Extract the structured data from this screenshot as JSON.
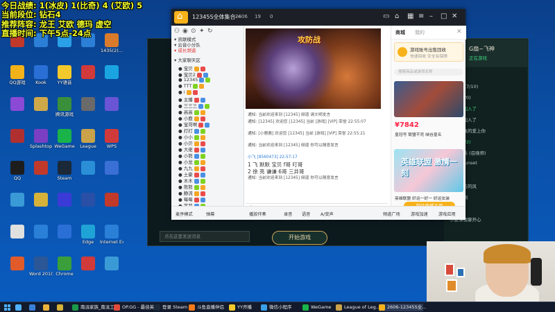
{
  "overlay": {
    "line1": "今日战绩: 1(冰皮) 1(比奇) 4 (艾欧) 5",
    "line2": "当前段位: 钻石4",
    "line3": "推荐阵容: 龙王 艾欧 德玛 虚空",
    "line4": "直播时间: 下午5点-24点"
  },
  "desktop_icons": [
    {
      "label": "",
      "color": "#c0392b"
    },
    {
      "label": "",
      "color": "#2b7fd6"
    },
    {
      "label": "",
      "color": "#2aa0e8"
    },
    {
      "label": "",
      "color": "#2b7fd6"
    },
    {
      "label": "1435(2)...",
      "color": "#d97b2a"
    },
    {
      "label": "QQ游戏",
      "color": "#f2b21a"
    },
    {
      "label": "Kook",
      "color": "#2a6fd6"
    },
    {
      "label": "YY语音",
      "color": "#f3c92b"
    },
    {
      "label": "",
      "color": "#d13a3a"
    },
    {
      "label": "",
      "color": "#1aa5e2"
    },
    {
      "label": "",
      "color": "#8a4ad6"
    },
    {
      "label": "",
      "color": "#cfa84a"
    },
    {
      "label": "腾讯游戏",
      "color": "#3a8f3a"
    },
    {
      "label": "",
      "color": "#6a6a6a"
    },
    {
      "label": "",
      "color": "#6a55d6"
    },
    {
      "label": "",
      "color": "#b03030"
    },
    {
      "label": "Splashtop",
      "color": "#7b3fc4"
    },
    {
      "label": "WeGame",
      "color": "#19b34a"
    },
    {
      "label": "League",
      "color": "#c9a24a"
    },
    {
      "label": "WPS",
      "color": "#d13a3a"
    },
    {
      "label": "QQ",
      "color": "#1d1d1d"
    },
    {
      "label": "",
      "color": "#c0392b"
    },
    {
      "label": "Steam",
      "color": "#1b2838"
    },
    {
      "label": "",
      "color": "#2a8fd6"
    },
    {
      "label": "",
      "color": "#3a6fd6"
    },
    {
      "label": "",
      "color": "#3a9ad6"
    },
    {
      "label": "",
      "color": "#d6b23a"
    },
    {
      "label": "",
      "color": "#3a3ad6"
    },
    {
      "label": "",
      "color": "#2a4fa6"
    },
    {
      "label": "",
      "color": "#c0392b"
    },
    {
      "label": "",
      "color": "#e0e0e0"
    },
    {
      "label": "",
      "color": "#2a7fd6"
    },
    {
      "label": "",
      "color": "#2a6fd6"
    },
    {
      "label": "Edge",
      "color": "#1fa3d6"
    },
    {
      "label": "Internet Explorer",
      "color": "#2a7fd6"
    },
    {
      "label": "",
      "color": "#e05a2a"
    },
    {
      "label": "Word 2010",
      "color": "#2b5797"
    },
    {
      "label": "Chrome",
      "color": "#3a9f3a"
    },
    {
      "label": "",
      "color": "#d13a3a"
    },
    {
      "label": "",
      "color": "#3a9ad6"
    }
  ],
  "douyu": {
    "title": "12345S全体集合···",
    "count1": "2606",
    "count2": "19",
    "count3": "0",
    "left_groups": [
      "凯联模式",
      "云音小分队",
      "成长频道",
      "大家聊天区",
      "大厅语音频"
    ],
    "users": [
      "宝贝",
      "宝贝2",
      "12345",
      "TTT",
      "i",
      "主播",
      "三三三",
      "高高",
      "小鹿",
      "宝哥啊",
      "打打",
      "小小",
      "小贝",
      "大佬",
      "小熊",
      "小龙",
      "九九",
      "土豪",
      "木木",
      "熊熊",
      "静流",
      "莓莓",
      "菲菲"
    ],
    "video_title": "攻防战",
    "chat": [
      "通知: 当前欢迎来到 [12345] 频道 请文明发言",
      "通知: [12345] 欢迎您 [12345] 当前 [游戏] [VIP] 荣誉 22:55:07",
      "通知: [小鹿酱] 欢迎您 [12345] 当前 [游戏] [VIP] 荣誉 22:55:21",
      "通知: 当前欢迎来到 [12345] 频道 你可以随意发言",
      "小飞 [8560473] 22:57:17",
      "1 飞 默默 宝贝 f哥 叮哥",
      "2 徐 亮 谦谦 6哥 三井哥",
      "通知: 当前欢迎来到 [12345] 频道 你可以随意发言"
    ],
    "right_tabs": [
      "商城",
      "我的"
    ],
    "reward_title": "游戏账号出售回收",
    "reward_sub": "快速回收 安全有保障",
    "search_placeholder": "搜索商品或游戏名称",
    "product1_price": "¥7842",
    "product1_label": "皇冠号 联盟不死 峡谷皇名",
    "product2_title": "英雄联盟 激情一刻",
    "product2_label": "英雄联盟 好运一好一 好运女装",
    "go_button": "前往商城主页",
    "bottom_items": [
      "麦序模式",
      "弹幕",
      "播放伴奏",
      "录音",
      "语音",
      "A/变声",
      "频道广场",
      "游戏加速",
      "游戏应用"
    ]
  },
  "league": {
    "me_name": "G扇~飞神",
    "me_status": "正在游戏",
    "friends": [
      "5/10",
      "一群字 (7/10)",
      "阿伦 (0/0)",
      "一个人加入了",
      "小黄人加入了",
      "遇见你真的爱上你",
      "哈比 (1/2)",
      "消灭小兵 (召唤师)",
      "NightSunset",
      "元龙成",
      "远在远方的风",
      "云中季桐",
      "云某某",
      "小麦深夜聊开心"
    ],
    "chat_placeholder": "点击这里发送消息",
    "start_game": "开始游戏"
  },
  "taskbar": [
    {
      "label": "",
      "color": "#4fb0ff"
    },
    {
      "label": "",
      "color": "#3a7fd6"
    },
    {
      "label": "",
      "color": "#e8b23a"
    },
    {
      "label": "",
      "color": "#d6b23a"
    },
    {
      "label": "南派家族_南派工...",
      "color": "#1a9a4a"
    },
    {
      "label": "OP.GG - 最佳英...",
      "color": "#e04a3a"
    },
    {
      "label": "登录 Steam",
      "color": "#1b2838"
    },
    {
      "label": "斗鱼直播伴侣",
      "color": "#f27a1a"
    },
    {
      "label": "YY开播",
      "color": "#f3c92b"
    },
    {
      "label": "微信小程序",
      "color": "#3aa0e8"
    },
    {
      "label": "WeGame",
      "color": "#19b34a"
    },
    {
      "label": "League of Leg...",
      "color": "#c9a24a"
    },
    {
      "label": "2606-12345S全...",
      "color": "#f7b21b"
    }
  ]
}
